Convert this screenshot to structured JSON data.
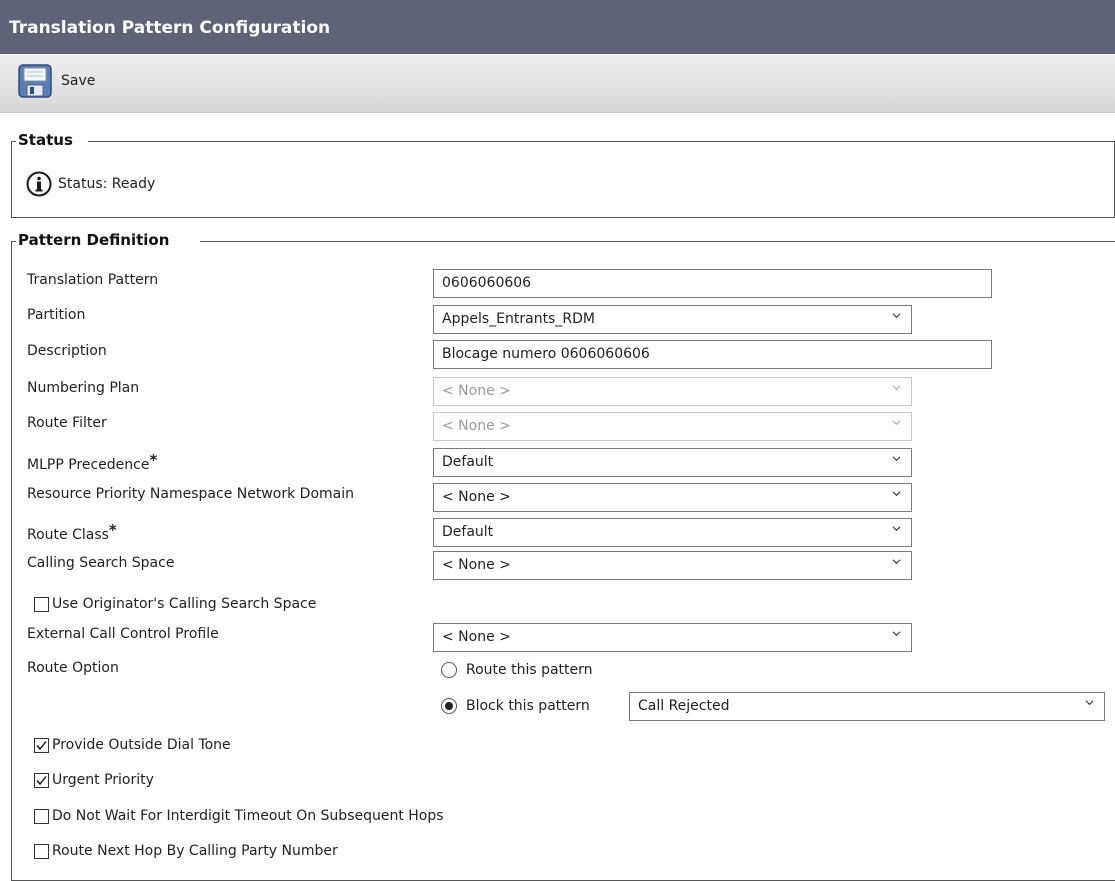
{
  "header": {
    "title": "Translation Pattern Configuration"
  },
  "toolbar": {
    "save_label": "Save",
    "save_icon": "floppy-disk-icon"
  },
  "status_section": {
    "legend": "Status",
    "icon": "info-icon",
    "text": "Status: Ready"
  },
  "pattern_section": {
    "legend": "Pattern Definition",
    "fields": {
      "translation_pattern": {
        "label": "Translation Pattern",
        "value": "0606060606"
      },
      "partition": {
        "label": "Partition",
        "value": "Appels_Entrants_RDM"
      },
      "description": {
        "label": "Description",
        "value": "Blocage numero 0606060606"
      },
      "numbering_plan": {
        "label": "Numbering Plan",
        "value": "< None >",
        "disabled": true
      },
      "route_filter": {
        "label": "Route Filter",
        "value": "< None >",
        "disabled": true
      },
      "mlpp_precedence": {
        "label": "MLPP Precedence",
        "required_mark": "*",
        "value": "Default"
      },
      "resource_priority": {
        "label": "Resource Priority Namespace Network Domain",
        "value": "< None >"
      },
      "route_class": {
        "label": "Route Class",
        "required_mark": "*",
        "value": "Default"
      },
      "calling_search_space": {
        "label": "Calling Search Space",
        "value": "< None >"
      },
      "use_originator_css": {
        "label": "Use Originator's Calling Search Space",
        "checked": false
      },
      "external_call_control": {
        "label": "External Call Control Profile",
        "value": "< None >"
      },
      "route_option": {
        "label": "Route Option",
        "route_label": "Route this pattern",
        "block_label": "Block this pattern",
        "selected": "block",
        "block_reason": "Call Rejected"
      }
    },
    "checkboxes": [
      {
        "label": "Provide Outside Dial Tone",
        "checked": true
      },
      {
        "label": "Urgent Priority",
        "checked": true
      },
      {
        "label": "Do Not Wait For Interdigit Timeout On Subsequent Hops",
        "checked": false
      },
      {
        "label": "Route Next Hop By Calling Party Number",
        "checked": false
      }
    ]
  },
  "colors": {
    "title_bar": "#5f6378",
    "toolbar": "#e0e0e0"
  }
}
